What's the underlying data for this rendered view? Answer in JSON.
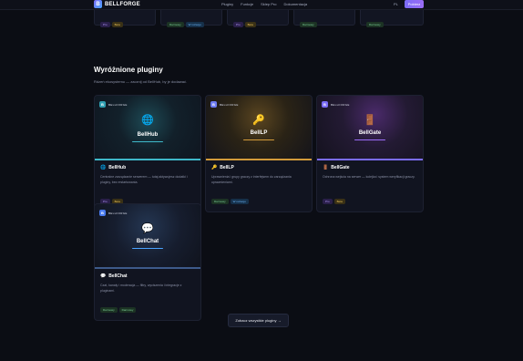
{
  "header": {
    "logo_letter": "B",
    "brand": "BELLFORGE",
    "nav": [
      "Pluginy",
      "Funkcje",
      "Sklep Pro",
      "Dokumentacja"
    ],
    "lang": "PL",
    "cta": "Pobierz"
  },
  "previous_row": [
    {
      "tags": [
        {
          "label": "Pro",
          "color": "purple"
        },
        {
          "label": "Beta",
          "color": "yellow"
        }
      ]
    },
    {
      "tags": [
        {
          "label": "Darmowy",
          "color": "green"
        },
        {
          "label": "W rozwoju",
          "color": "blue"
        }
      ]
    },
    {
      "tags": [
        {
          "label": "Pro",
          "color": "purple"
        },
        {
          "label": "Beta",
          "color": "yellow"
        }
      ]
    },
    {
      "tags": [
        {
          "label": "Darmowy",
          "color": "green"
        }
      ]
    },
    {
      "tags": [
        {
          "label": "Darmowy",
          "color": "green"
        }
      ]
    }
  ],
  "section": {
    "title": "Wyróżnione pluginy",
    "subtitle": "Rdzeń ekosystemu — zacznij od BellHub, by je dodawać."
  },
  "cards": [
    {
      "brand": "BELLFORGE",
      "brand_icon": "B",
      "symbol_icon": "globe-icon",
      "symbol": "🌐",
      "name": "BellHub",
      "title_icon": "🌐",
      "title": "BellHub",
      "description": "Centralne zarządzanie serwerem — tutaj aktywujesz dodatki i pluginy, bez restartowania.",
      "tags": [
        {
          "label": "Pro",
          "color": "purple"
        },
        {
          "label": "Beta",
          "color": "yellow"
        }
      ],
      "accent": "#3fb8c9"
    },
    {
      "brand": "BELLFORGE",
      "brand_icon": "B",
      "symbol_icon": "key-icon",
      "symbol": "🔑",
      "name": "BellLP",
      "title_icon": "🔑",
      "title": "BellLP",
      "description": "Uprawnienia i grupy graczy z interfejsem do zarządzania uprawnieniami.",
      "tags": [
        {
          "label": "Darmowy",
          "color": "green"
        },
        {
          "label": "W rozwoju",
          "color": "blue"
        }
      ],
      "accent": "#d39b3a"
    },
    {
      "brand": "BELLFORGE",
      "brand_icon": "B",
      "symbol_icon": "door-icon",
      "symbol": "🚪",
      "name": "BellGate",
      "title_icon": "🚪",
      "title": "BellGate",
      "description": "Ochrona wejścia na serwer — kolejka i system weryfikacji graczy.",
      "tags": [
        {
          "label": "Pro",
          "color": "purple"
        },
        {
          "label": "Beta",
          "color": "yellow"
        }
      ],
      "accent": "#9a6cf6"
    },
    {
      "brand": "BELLFORGE",
      "brand_icon": "B",
      "symbol_icon": "speech-bubble-icon",
      "symbol": "💬",
      "name": "BellChat",
      "title_icon": "💬",
      "title": "BellChat",
      "description": "Czat, kanały i moderacja — filtry, wyciszenia i integracje z pluginami.",
      "tags": [
        {
          "label": "Darmowy",
          "color": "green"
        },
        {
          "label": "Darmowy",
          "color": "green"
        }
      ],
      "accent": "#4aa3ff"
    }
  ],
  "cta": {
    "label": "Zobacz wszystkie pluginy →"
  },
  "colors": {
    "background": "#0b0d14",
    "card": "#111420",
    "accent": "#7b6cf6"
  }
}
